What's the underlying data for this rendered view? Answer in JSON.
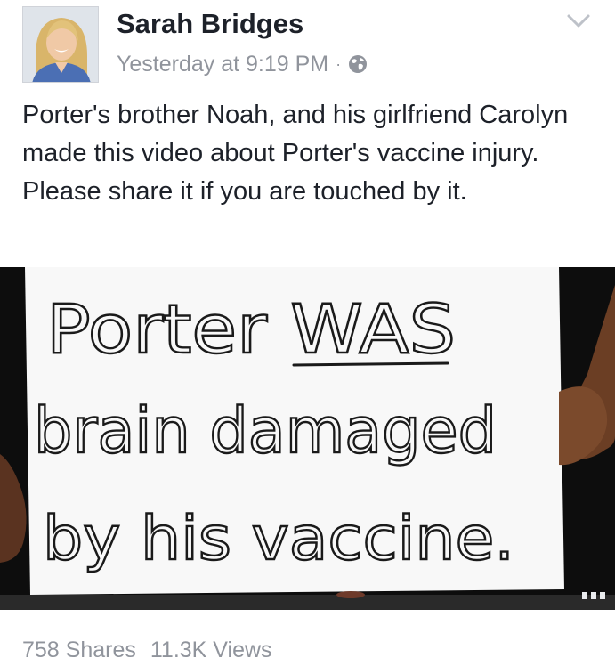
{
  "post": {
    "author": {
      "name": "Sarah Bridges",
      "avatar_icon": "profile-photo"
    },
    "timestamp": "Yesterday at 9:19 PM",
    "separator": "·",
    "audience_icon": "globe-icon",
    "menu_icon": "chevron-down-icon",
    "text": "Porter's brother Noah, and his girlfriend Carolyn made this video about Porter's vaccine injury. Please share it if you are touched by it.",
    "video": {
      "sign_lines": [
        "Porter WAS",
        "brain damaged",
        "by his vaccine."
      ],
      "quality_icon": "video-quality-icon"
    },
    "stats": {
      "shares": "758 Shares",
      "views": "11.3K Views"
    }
  },
  "colors": {
    "author": "#1d2129",
    "meta": "#90949c",
    "text": "#1d2129",
    "video_bg": "#0d0d0d",
    "sign": "#f8f8f8",
    "ink": "#1a1a1a"
  }
}
